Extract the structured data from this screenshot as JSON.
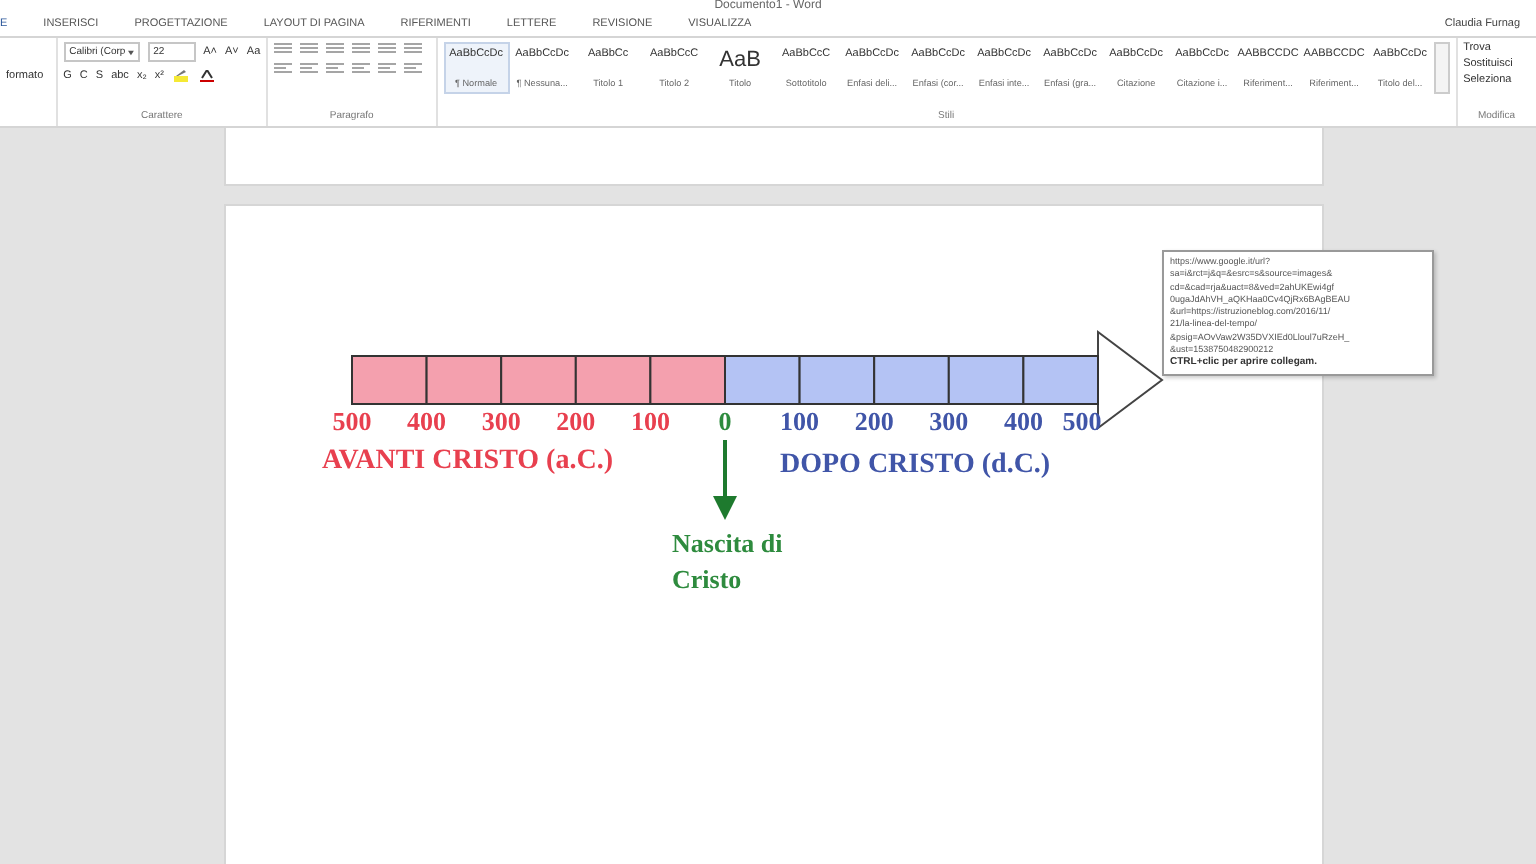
{
  "window": {
    "title": "Documento1 - Word",
    "user": "Claudia Furnag"
  },
  "tabs": [
    {
      "label": "E",
      "selected": true
    },
    {
      "label": "INSERISCI",
      "selected": false
    },
    {
      "label": "PROGETTAZIONE",
      "selected": false
    },
    {
      "label": "LAYOUT DI PAGINA",
      "selected": false
    },
    {
      "label": "RIFERIMENTI",
      "selected": false
    },
    {
      "label": "LETTERE",
      "selected": false
    },
    {
      "label": "REVISIONE",
      "selected": false
    },
    {
      "label": "VISUALIZZA",
      "selected": false
    }
  ],
  "clipboard": {
    "label": "formato"
  },
  "font_group": {
    "font": "Calibri (Corp",
    "size": "22",
    "buttons_row1": [
      "A˄",
      "A˅",
      "Aa"
    ],
    "buttons_row2": [
      "G",
      "C",
      "S",
      "abc",
      "x₂",
      "x²"
    ],
    "label": "Carattere"
  },
  "paragraph_group": {
    "label": "Paragrafo"
  },
  "styles_group": {
    "label": "Stili",
    "items": [
      {
        "preview": "AaBbCcDc",
        "name": "¶ Normale",
        "selected": true
      },
      {
        "preview": "AaBbCcDc",
        "name": "¶ Nessuna...",
        "selected": false
      },
      {
        "preview": "AaBbCc",
        "name": "Titolo 1",
        "selected": false
      },
      {
        "preview": "AaBbCcC",
        "name": "Titolo 2",
        "selected": false
      },
      {
        "preview": "AaB",
        "name": "Titolo",
        "selected": false
      },
      {
        "preview": "AaBbCcC",
        "name": "Sottotitolo",
        "selected": false
      },
      {
        "preview": "AaBbCcDc",
        "name": "Enfasi deli...",
        "selected": false
      },
      {
        "preview": "AaBbCcDc",
        "name": "Enfasi (cor...",
        "selected": false
      },
      {
        "preview": "AaBbCcDc",
        "name": "Enfasi inte...",
        "selected": false
      },
      {
        "preview": "AaBbCcDc",
        "name": "Enfasi (gra...",
        "selected": false
      },
      {
        "preview": "AaBbCcDc",
        "name": "Citazione",
        "selected": false
      },
      {
        "preview": "AaBbCcDc",
        "name": "Citazione i...",
        "selected": false
      },
      {
        "preview": "AABBCCDC",
        "name": "Riferiment...",
        "selected": false
      },
      {
        "preview": "AABBCCDC",
        "name": "Riferiment...",
        "selected": false
      },
      {
        "preview": "AaBbCcDc",
        "name": "Titolo del...",
        "selected": false
      }
    ]
  },
  "editing_group": {
    "label": "Modifica",
    "items": [
      "Trova",
      "Sostituisci",
      "Seleziona"
    ]
  },
  "timeline": {
    "bc_ticks": [
      "500",
      "400",
      "300",
      "200",
      "100"
    ],
    "zero": "0",
    "ad_ticks": [
      "100",
      "200",
      "300",
      "400",
      "500"
    ],
    "bc_caption": "AVANTI CRISTO (a.C.)",
    "ad_caption": "DOPO CRISTO (d.C.)",
    "birth_label": [
      "Nascita di",
      "Cristo"
    ]
  },
  "tooltip": {
    "lines": [
      "https://www.google.it/url?",
      "sa=i&rct=j&q=&esrc=s&source=images&",
      "cd=&cad=rja&uact=8&ved=2ahUKEwi4gf",
      "0ugaJdAhVH_aQKHaa0Cv4QjRx6BAgBEAU",
      "&url=https://istruzioneblog.com/2016/11/",
      "21/la-linea-del-tempo/",
      "&psig=AOvVaw2W35DVXIEd0Lloul7uRzeH_",
      "&ust=1538750482900212"
    ],
    "hint": "CTRL+clic per aprire collegam."
  }
}
